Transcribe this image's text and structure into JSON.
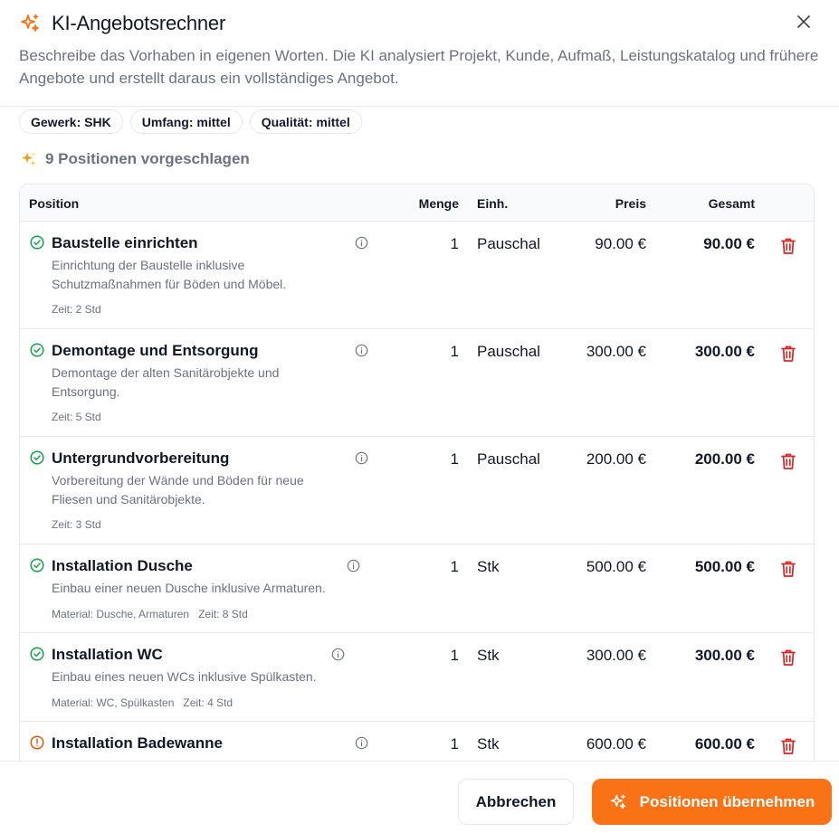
{
  "dialog": {
    "title": "KI-Angebotsrechner",
    "description": "Beschreibe das Vorhaben in eigenen Worten. Die KI analysiert Projekt, Kunde, Aufmaß, Leistungskatalog und frühere Angebote und erstellt daraus ein vollständiges Angebot."
  },
  "chips": [
    {
      "label": "Gewerk: SHK"
    },
    {
      "label": "Umfang: mittel"
    },
    {
      "label": "Qualität: mittel"
    }
  ],
  "suggestions": {
    "label": "9 Positionen vorgeschlagen"
  },
  "table": {
    "headers": {
      "position": "Position",
      "menge": "Menge",
      "einheit": "Einh.",
      "preis": "Preis",
      "gesamt": "Gesamt"
    },
    "rows": [
      {
        "title": "Baustelle einrichten",
        "description": "Einrichtung der Baustelle inklusive Schutzmaßnahmen für Böden und Möbel.",
        "material": "",
        "zeit": "Zeit: 2 Std",
        "menge": "1",
        "einheit": "Pauschal",
        "preis": "90.00 €",
        "gesamt": "90.00 €",
        "status": "ok"
      },
      {
        "title": "Demontage und Entsorgung",
        "description": "Demontage der alten Sanitärobjekte und Entsorgung.",
        "material": "",
        "zeit": "Zeit: 5 Std",
        "menge": "1",
        "einheit": "Pauschal",
        "preis": "300.00 €",
        "gesamt": "300.00 €",
        "status": "ok"
      },
      {
        "title": "Untergrundvorbereitung",
        "description": "Vorbereitung der Wände und Böden für neue Fliesen und Sanitärobjekte.",
        "material": "",
        "zeit": "Zeit: 3 Std",
        "menge": "1",
        "einheit": "Pauschal",
        "preis": "200.00 €",
        "gesamt": "200.00 €",
        "status": "ok"
      },
      {
        "title": "Installation Dusche",
        "description": "Einbau einer neuen Dusche inklusive Armaturen.",
        "material": "Material: Dusche, Armaturen",
        "zeit": "Zeit: 8 Std",
        "menge": "1",
        "einheit": "Stk",
        "preis": "500.00 €",
        "gesamt": "500.00 €",
        "status": "ok"
      },
      {
        "title": "Installation WC",
        "description": "Einbau eines neuen WCs inklusive Spülkasten.",
        "material": "Material: WC, Spülkasten",
        "zeit": "Zeit: 4 Std",
        "menge": "1",
        "einheit": "Stk",
        "preis": "300.00 €",
        "gesamt": "300.00 €",
        "status": "ok"
      },
      {
        "title": "Installation Badewanne",
        "description": "",
        "material": "",
        "zeit": "",
        "menge": "1",
        "einheit": "Stk",
        "preis": "600.00 €",
        "gesamt": "600.00 €",
        "status": "warning"
      }
    ]
  },
  "footer": {
    "cancel_label": "Abbrechen",
    "apply_label": "Positionen übernehmen"
  },
  "colors": {
    "accent": "#f97316",
    "ok": "#16a34a",
    "warning": "#ea580c",
    "delete": "#dc2626"
  },
  "icons": {
    "title": "sparkles-icon",
    "close": "close-icon",
    "suggest": "sparkle-emoji-icon",
    "ok": "check-circle-icon",
    "warning": "alert-circle-icon",
    "info": "info-icon",
    "delete": "trash-icon"
  }
}
